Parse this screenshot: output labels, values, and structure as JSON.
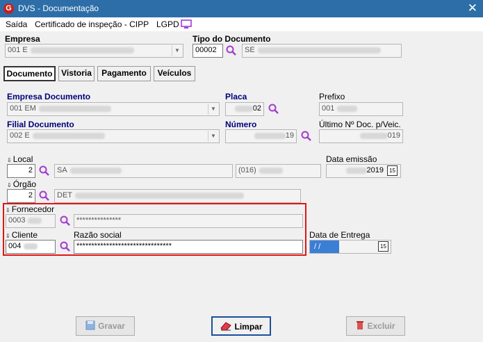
{
  "window": {
    "title": "DVS - Documentação",
    "close_glyph": "✕",
    "app_icon_letter": "G"
  },
  "menu": {
    "saida": "Saída",
    "certificado": "Certificado de inspeção - CIPP",
    "lgpd": "LGPD"
  },
  "empresa": {
    "label": "Empresa",
    "value": "001 E"
  },
  "tipo_documento": {
    "label": "Tipo do Documento",
    "code": "00002",
    "name": "SE"
  },
  "tabs": [
    "Documento",
    "Vistoria",
    "Pagamento",
    "Veículos"
  ],
  "empresa_documento": {
    "label": "Empresa Documento",
    "value": "001 EM"
  },
  "placa": {
    "label": "Placa",
    "value": "02"
  },
  "prefixo": {
    "label": "Prefixo",
    "value": "001"
  },
  "filial_documento": {
    "label": "Filial Documento",
    "value": "002 E"
  },
  "numero": {
    "label": "Número",
    "value": "19"
  },
  "ultimo_doc": {
    "label": "Último Nº Doc. p/Veic.",
    "value": "019"
  },
  "local": {
    "label": "Local",
    "code": "2",
    "name": "SA",
    "phone": "(016)"
  },
  "data_emissao": {
    "label": "Data emissão",
    "value": "2019",
    "cal": "15"
  },
  "orgao": {
    "label": "Órgão",
    "code": "2",
    "name": "DET"
  },
  "fornecedor": {
    "label": "Fornecedor",
    "code": "0003",
    "name": "***************"
  },
  "cliente": {
    "label": "Cliente",
    "code": "004",
    "razao_label": "Razão social",
    "razao_value": "********************************"
  },
  "data_entrega": {
    "label": "Data de Entrega",
    "value": " /  /",
    "cal": "15"
  },
  "buttons": {
    "gravar": "Gravar",
    "limpar": "Limpar",
    "excluir": "Excluir"
  },
  "colors": {
    "titlebar": "#2d6ea8",
    "highlight": "#e01616",
    "label_blue": "#00007a"
  }
}
